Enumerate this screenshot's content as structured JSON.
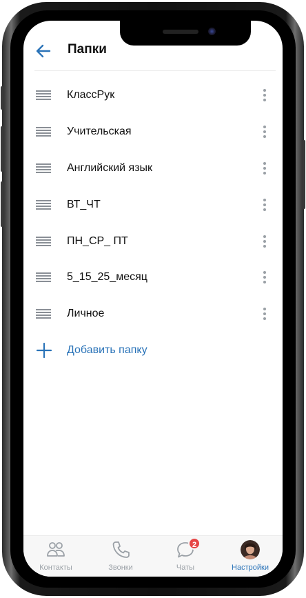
{
  "header": {
    "title": "Папки",
    "back_icon": "arrow-left-icon"
  },
  "folders": [
    {
      "name": "КлассРук"
    },
    {
      "name": "Учительская"
    },
    {
      "name": "Английский язык"
    },
    {
      "name": "ВТ_ЧТ"
    },
    {
      "name": "ПН_СР_ ПТ"
    },
    {
      "name": "5_15_25_месяц"
    },
    {
      "name": "Личное"
    }
  ],
  "add_folder": {
    "label": "Добавить папку",
    "icon": "plus-icon"
  },
  "tabbar": {
    "tabs": [
      {
        "label": "Контакты",
        "icon": "contacts-icon"
      },
      {
        "label": "Звонки",
        "icon": "phone-icon"
      },
      {
        "label": "Чаты",
        "icon": "chat-icon",
        "badge": "2"
      },
      {
        "label": "Настройки",
        "icon": "avatar",
        "active": true
      }
    ]
  },
  "colors": {
    "accent": "#2a73b8",
    "badge": "#e64646",
    "text_primary": "#111111",
    "text_secondary": "#9aa0a6"
  }
}
